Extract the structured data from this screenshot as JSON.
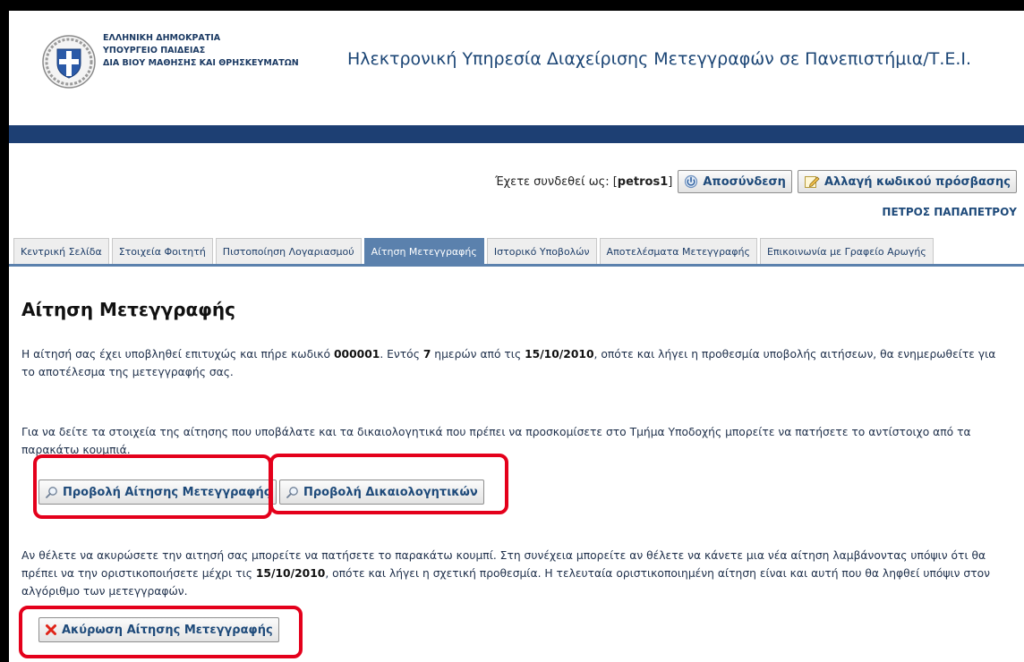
{
  "header": {
    "ministry_lines": [
      "ΕΛΛΗΝΙΚΗ ΔΗΜΟΚΡΑΤΙΑ",
      "ΥΠΟΥΡΓΕΙΟ ΠΑΙΔΕΙΑΣ",
      "ΔΙΑ ΒΙΟΥ ΜΑΘΗΣΗΣ ΚΑΙ ΘΡΗΣΚΕΥΜΑΤΩΝ"
    ],
    "site_title": "Ηλεκτρονική Υπηρεσία Διαχείρισης Μετεγγραφών σε Πανεπιστήμια/Τ.Ε.Ι.",
    "emblem_icon": "greek-coat-of-arms-icon"
  },
  "user": {
    "logged_in_prefix": "Έχετε συνδεθεί ως: [",
    "username": "petros1",
    "logged_in_suffix": "]",
    "logout_label": "Αποσύνδεση",
    "logout_icon": "logout-icon",
    "change_password_label": "Αλλαγή κωδικού πρόσβασης",
    "change_password_icon": "edit-icon",
    "full_name": "ΠΕΤΡΟΣ ΠΑΠΑΠΕΤΡΟΥ"
  },
  "tabs": [
    {
      "label": "Κεντρική Σελίδα",
      "active": false
    },
    {
      "label": "Στοιχεία Φοιτητή",
      "active": false
    },
    {
      "label": "Πιστοποίηση Λογαριασμού",
      "active": false
    },
    {
      "label": "Αίτηση Μετεγγραφής",
      "active": true
    },
    {
      "label": "Ιστορικό Υποβολών",
      "active": false
    },
    {
      "label": "Αποτελέσματα Μετεγγραφής",
      "active": false
    },
    {
      "label": "Επικοινωνία με Γραφείο Αρωγής",
      "active": false
    }
  ],
  "main": {
    "heading": "Αίτηση Μετεγγραφής",
    "para1": {
      "t1": "Η αίτησή σας έχει υποβληθεί επιτυχώς και πήρε κωδικό ",
      "code": "000001",
      "t2": ". Εντός ",
      "days": "7",
      "t3": " ημερών από τις ",
      "date": "15/10/2010",
      "t4": ", οπότε και λήγει η προθεσμία υποβολής αιτήσεων, θα ενημερωθείτε για το αποτέλεσμα της μετεγγραφής σας."
    },
    "para2": "Για να δείτε τα στοιχεία της αίτησης που υποβάλατε και τα δικαιολογητικά που πρέπει να προσκομίσετε στο Τμήμα Υποδοχής μπορείτε να πατήσετε το αντίστοιχο από τα παρακάτω κουμπιά.",
    "view_application_label": "Προβολή Αίτησης Μετεγγραφής",
    "view_documents_label": "Προβολή Δικαιολογητικών",
    "search_icon": "search-icon",
    "para3": {
      "t1": "Αν θέλετε να ακυρώσετε την αιτησή σας μπορείτε να πατήσετε το παρακάτω κουμπί. Στη συνέχεια μπορείτε αν θέλετε να κάνετε μια νέα αίτηση λαμβάνοντας υπόψιν ότι θα πρέπει να την οριστικοποιήσετε μέχρι τις ",
      "date": "15/10/2010",
      "t2": ", οπότε και λήγει η σχετική προθεσμία. Η τελευταία οριστικοποιημένη αίτηση είναι και αυτή που θα ληφθεί υπόψιν στον αλγόριθμο των μετεγγραφών."
    },
    "cancel_label": "Ακύρωση Αίτησης Μετεγγραφής",
    "cancel_icon": "red-x-icon"
  },
  "colors": {
    "band": "#1d3f73",
    "active_tab": "#5b81ad",
    "highlight": "#e4001b",
    "link_text": "#1e4a7a"
  }
}
